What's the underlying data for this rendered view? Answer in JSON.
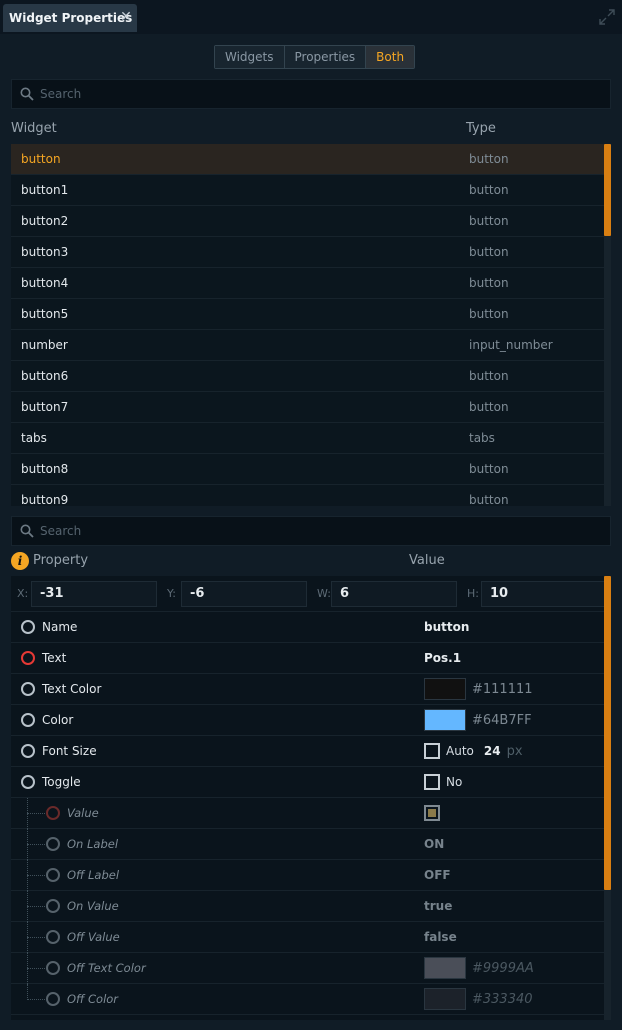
{
  "tab": {
    "title": "Widget Properties"
  },
  "view_toggle": {
    "options": [
      "Widgets",
      "Properties",
      "Both"
    ],
    "active_index": 2
  },
  "widget_search": {
    "placeholder": "Search"
  },
  "widget_table": {
    "col_widget": "Widget",
    "col_type": "Type",
    "rows": [
      {
        "name": "button",
        "type": "button"
      },
      {
        "name": "button1",
        "type": "button"
      },
      {
        "name": "button2",
        "type": "button"
      },
      {
        "name": "button3",
        "type": "button"
      },
      {
        "name": "button4",
        "type": "button"
      },
      {
        "name": "button5",
        "type": "button"
      },
      {
        "name": "number",
        "type": "input_number"
      },
      {
        "name": "button6",
        "type": "button"
      },
      {
        "name": "button7",
        "type": "button"
      },
      {
        "name": "tabs",
        "type": "tabs"
      },
      {
        "name": "button8",
        "type": "button"
      },
      {
        "name": "button9",
        "type": "button"
      }
    ]
  },
  "property_search": {
    "placeholder": "Search"
  },
  "property_table": {
    "col_property": "Property",
    "col_value": "Value",
    "geometry": {
      "x_label": "X:",
      "x": "-31",
      "y_label": "Y:",
      "y": "-6",
      "w_label": "W:",
      "w": "6",
      "h_label": "H:",
      "h": "10"
    },
    "name_label": "Name",
    "name_value": "button",
    "text_label": "Text",
    "text_value": "Pos.1",
    "text_color_label": "Text Color",
    "text_color_value": "#111111",
    "color_label": "Color",
    "color_value": "#64B7FF",
    "font_size_label": "Font Size",
    "font_size_auto": "Auto",
    "font_size_value": "24",
    "font_size_unit": "px",
    "toggle_label": "Toggle",
    "toggle_value": "No",
    "value_label": "Value",
    "on_label_label": "On Label",
    "on_label_value": "ON",
    "off_label_label": "Off Label",
    "off_label_value": "OFF",
    "on_value_label": "On Value",
    "on_value_value": "true",
    "off_value_label": "Off Value",
    "off_value_value": "false",
    "off_text_color_label": "Off Text Color",
    "off_text_color_value": "#9999AA",
    "off_color_label": "Off Color",
    "off_color_value": "#333340"
  },
  "colors": {
    "accent": "#f5a623",
    "scrollbar": "#d97f12",
    "text_color_swatch": "#111111",
    "color_swatch": "#64B7FF",
    "off_text_color_swatch": "#4a4e58",
    "off_color_swatch": "#1c222a"
  }
}
